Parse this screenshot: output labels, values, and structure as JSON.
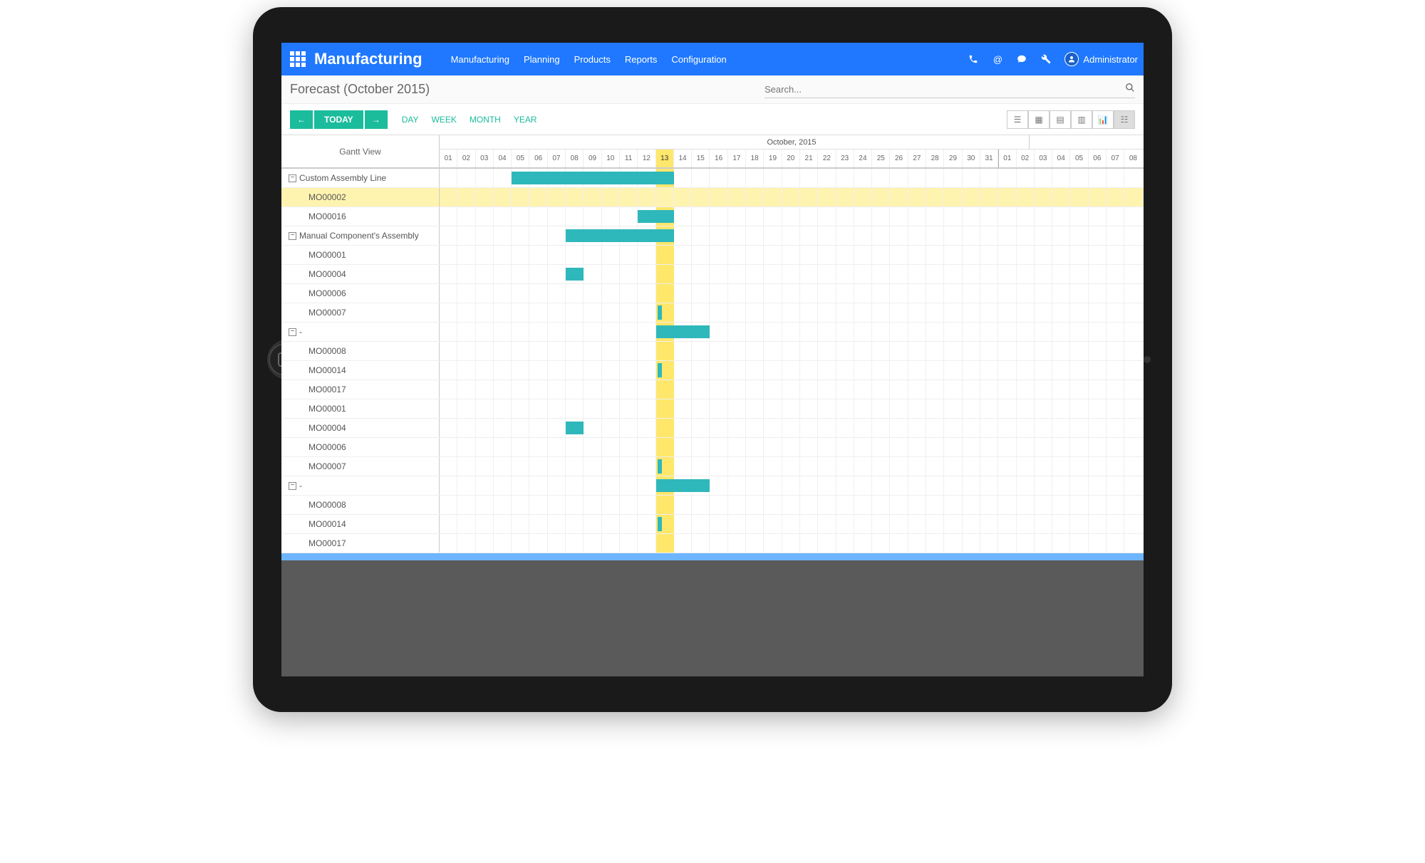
{
  "header": {
    "app_title": "Manufacturing",
    "nav": [
      "Manufacturing",
      "Planning",
      "Products",
      "Reports",
      "Configuration"
    ],
    "user": "Administrator"
  },
  "subheader": {
    "page_title": "Forecast (October 2015)",
    "search_placeholder": "Search..."
  },
  "controls": {
    "today": "TODAY",
    "ranges": [
      "DAY",
      "WEEK",
      "MONTH",
      "YEAR"
    ]
  },
  "gantt": {
    "view_label": "Gantt View",
    "month_label": "October, 2015",
    "today_index": 12,
    "days": [
      "01",
      "02",
      "03",
      "04",
      "05",
      "06",
      "07",
      "08",
      "09",
      "10",
      "11",
      "12",
      "13",
      "14",
      "15",
      "16",
      "17",
      "18",
      "19",
      "20",
      "21",
      "22",
      "23",
      "24",
      "25",
      "26",
      "27",
      "28",
      "29",
      "30",
      "31",
      "01",
      "02",
      "03",
      "04",
      "05",
      "06",
      "07",
      "08"
    ],
    "rows": [
      {
        "label": "Custom Assembly Line",
        "type": "group",
        "bar": {
          "start": 4,
          "span": 9
        }
      },
      {
        "label": "MO00002",
        "type": "item",
        "highlight": true
      },
      {
        "label": "MO00016",
        "type": "item",
        "bar": {
          "start": 11,
          "span": 2
        }
      },
      {
        "label": "Manual Component's Assembly",
        "type": "group",
        "bar": {
          "start": 7,
          "span": 6
        }
      },
      {
        "label": "MO00001",
        "type": "item"
      },
      {
        "label": "MO00004",
        "type": "item",
        "bar": {
          "start": 7,
          "span": 1
        }
      },
      {
        "label": "MO00006",
        "type": "item"
      },
      {
        "label": "MO00007",
        "type": "item",
        "thin": {
          "at": 12
        }
      },
      {
        "label": "-",
        "type": "group",
        "bar": {
          "start": 12,
          "span": 3
        }
      },
      {
        "label": "MO00008",
        "type": "item"
      },
      {
        "label": "MO00014",
        "type": "item",
        "thin": {
          "at": 12
        }
      },
      {
        "label": "MO00017",
        "type": "item"
      },
      {
        "label": "MO00001",
        "type": "item"
      },
      {
        "label": "MO00004",
        "type": "item",
        "bar": {
          "start": 7,
          "span": 1
        }
      },
      {
        "label": "MO00006",
        "type": "item"
      },
      {
        "label": "MO00007",
        "type": "item",
        "thin": {
          "at": 12
        }
      },
      {
        "label": "-",
        "type": "group",
        "bar": {
          "start": 12,
          "span": 3
        }
      },
      {
        "label": "MO00008",
        "type": "item"
      },
      {
        "label": "MO00014",
        "type": "item",
        "thin": {
          "at": 12
        }
      },
      {
        "label": "MO00017",
        "type": "item"
      }
    ]
  }
}
